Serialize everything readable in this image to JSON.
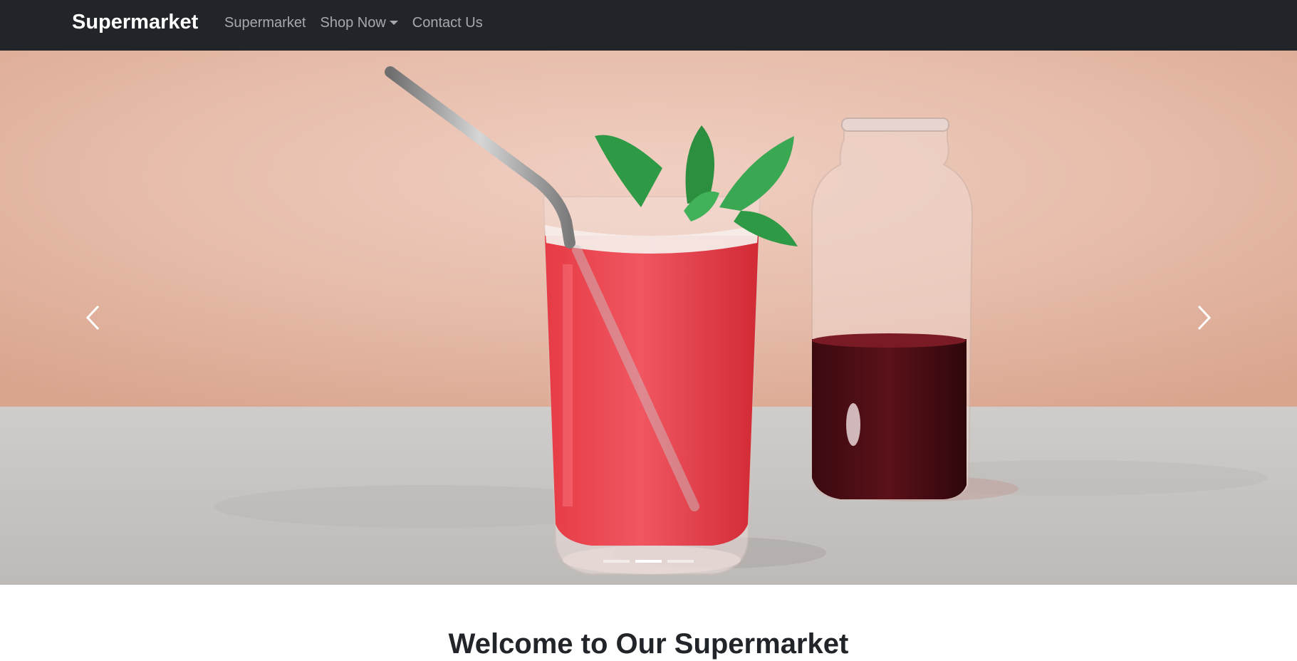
{
  "navbar": {
    "brand": "Supermarket",
    "links": [
      {
        "label": "Supermarket"
      },
      {
        "label": "Shop Now",
        "dropdown": true
      },
      {
        "label": "Contact Us"
      }
    ],
    "background": "#212529"
  },
  "carousel": {
    "slides": 3,
    "active_slide": 2,
    "slide_subject": "red sparkling drink with metal straw and mint beside glass bottle of dark syrup"
  },
  "main": {
    "heading": "Welcome to Our Supermarket"
  }
}
